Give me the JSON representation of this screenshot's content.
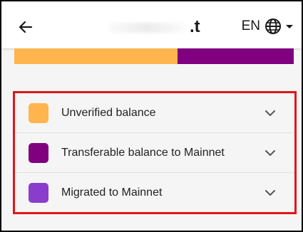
{
  "header": {
    "back_label": "Back",
    "title_visible": ".t",
    "lang_code": "EN"
  },
  "balance_bar": {
    "segments": [
      {
        "name": "Unverified balance",
        "fraction": 0.585,
        "color": "#ffb54d"
      },
      {
        "name": "Transferable balance to Mainnet",
        "fraction": 0.415,
        "color": "#800080"
      }
    ]
  },
  "legend": {
    "items": [
      {
        "label": "Unverified balance",
        "color": "#ffb54d",
        "icon": "chevron-down-icon"
      },
      {
        "label": "Transferable balance to Mainnet",
        "color": "#800080",
        "icon": "chevron-down-icon"
      },
      {
        "label": "Migrated to Mainnet",
        "color": "#8a3dcc",
        "icon": "chevron-down-icon"
      }
    ]
  },
  "colors": {
    "highlight_border": "#e3141b",
    "background": "#f5f5f5"
  }
}
